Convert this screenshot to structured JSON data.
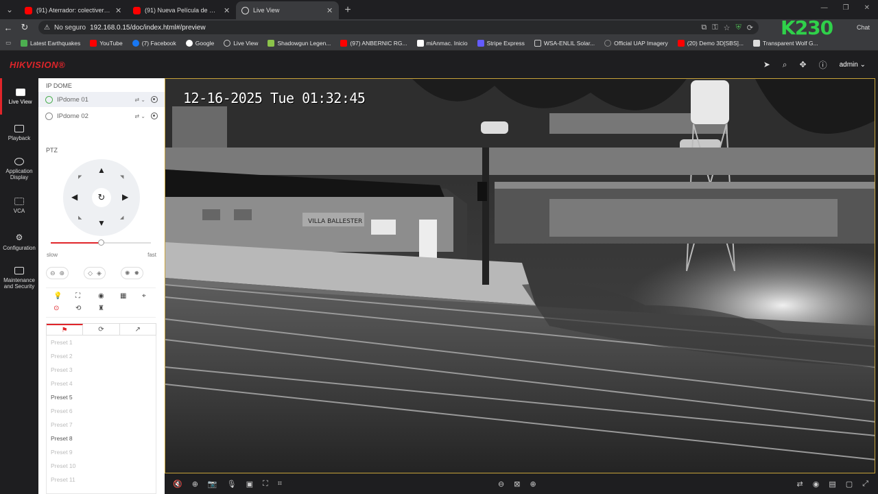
{
  "browser": {
    "tabs": [
      {
        "title": "(91) Aterrador: colectivero salteño",
        "fav": "#ff0000",
        "active": false
      },
      {
        "title": "(91) Nueva Película de Steven Spi",
        "fav": "#ff0000",
        "active": false
      },
      {
        "title": "Live View",
        "fav": "#dddddd",
        "active": true
      }
    ],
    "insecure_label": "No seguro",
    "url": "192.168.0.15/doc/index.html#/preview",
    "brand_logo": "K230",
    "chat_label": "Chat",
    "bookmarks": [
      {
        "label": "Latest Earthquakes",
        "color": "#4caf50"
      },
      {
        "label": "YouTube",
        "color": "#ff0000"
      },
      {
        "label": "(7) Facebook",
        "color": "#1877f2"
      },
      {
        "label": "Google",
        "color": "#ffffff"
      },
      {
        "label": "Live View",
        "color": "#cccccc"
      },
      {
        "label": "Shadowgun Legen...",
        "color": "#8bc34a"
      },
      {
        "label": "(97) ANBERNIC RG...",
        "color": "#ff0000"
      },
      {
        "label": "miAnmac. Inicio",
        "color": "#ffffff"
      },
      {
        "label": "Stripe Express",
        "color": "#635bff"
      },
      {
        "label": "WSA-ENLIL Solar...",
        "color": "#cccccc"
      },
      {
        "label": "Official UAP Imagery",
        "color": "#888888"
      },
      {
        "label": "(20) Demo 3D[SBS]...",
        "color": "#ff0000"
      },
      {
        "label": "Transparent Wolf G...",
        "color": "#dddddd"
      }
    ]
  },
  "app": {
    "brand": "HIKVISION®",
    "user": "admin",
    "nav": [
      {
        "label": "Live View",
        "active": true
      },
      {
        "label": "Playback",
        "active": false
      },
      {
        "label": "Application Display",
        "active": false
      },
      {
        "label": "VCA",
        "active": false
      },
      {
        "label": "Configuration",
        "active": false
      },
      {
        "label": "Maintenance and Security",
        "active": false
      }
    ]
  },
  "panel": {
    "section_title": "IP DOME",
    "cameras": [
      "IPdome 01",
      "IPdome 02"
    ],
    "ptz_title": "PTZ",
    "speed_slow": "slow",
    "speed_fast": "fast",
    "speed_level": 0.5,
    "presets": [
      {
        "label": "Preset 1",
        "set": false
      },
      {
        "label": "Preset 2",
        "set": false
      },
      {
        "label": "Preset 3",
        "set": false
      },
      {
        "label": "Preset 4",
        "set": false
      },
      {
        "label": "Preset 5",
        "set": true
      },
      {
        "label": "Preset 6",
        "set": false
      },
      {
        "label": "Preset 7",
        "set": false
      },
      {
        "label": "Preset 8",
        "set": true
      },
      {
        "label": "Preset 9",
        "set": false
      },
      {
        "label": "Preset 10",
        "set": false
      },
      {
        "label": "Preset 11",
        "set": false
      }
    ]
  },
  "video": {
    "osd_timestamp": "12-16-2025 Tue 01:32:45",
    "station_sign": "VILLA BALLESTER"
  }
}
